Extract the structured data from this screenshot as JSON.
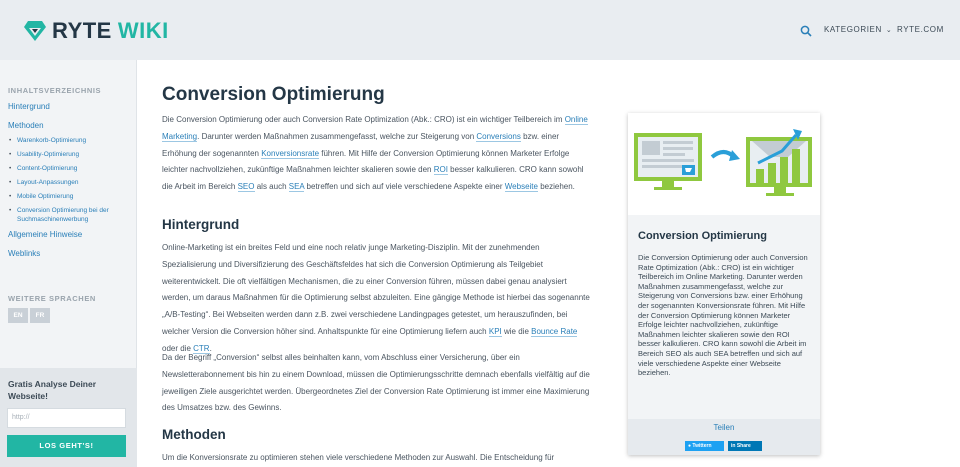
{
  "header": {
    "logo_ryte": "RYTE",
    "logo_wiki": "WIKI",
    "nav_kategorien": "KATEGORIEN",
    "nav_ryte": "RYTE.COM",
    "brand_color": "#22b6a4"
  },
  "sidebar": {
    "toc_heading": "INHALTSVERZEICHNIS",
    "toc": [
      {
        "label": "Hintergrund"
      },
      {
        "label": "Methoden"
      },
      {
        "label": "Warenkorb-Optimierung"
      },
      {
        "label": "Usability-Optimierung"
      },
      {
        "label": "Content-Optimierung"
      },
      {
        "label": "Layout-Anpassungen"
      },
      {
        "label": "Mobile Optimierung"
      },
      {
        "label": "Conversion Optimierung bei der Suchmaschinenwerbung"
      },
      {
        "label": "Allgemeine Hinweise"
      },
      {
        "label": "Weblinks"
      }
    ],
    "lang_heading": "WEITERE SPRACHEN",
    "langs": [
      "EN",
      "FR"
    ],
    "cta": {
      "title": "Gratis Analyse Deiner Webseite!",
      "placeholder": "http://",
      "button": "LOS GEHT'S!"
    }
  },
  "main": {
    "title": "Conversion Optimierung",
    "intro": {
      "t1": "Die Conversion Optimierung oder auch Conversion Rate Optimization (Abk.: CRO) ist ein wichtiger Teilbereich im ",
      "l1": "Online Marketing",
      "t2": ". Darunter werden Maßnahmen zusammengefasst, welche zur Steigerung von ",
      "l2": "Conversions",
      "t3": " bzw. einer Erhöhung der sogenannten ",
      "l3": "Konversionsrate",
      "t4": " führen. Mit Hilfe der Conversion Optimierung können Marketer Erfolge leichter nachvollziehen, zukünftige Maßnahmen leichter skalieren sowie den ",
      "l4": "ROI",
      "t5": " besser kalkulieren. CRO kann sowohl die Arbeit im Bereich ",
      "l5": "SEO",
      "t6": " als auch ",
      "l6": "SEA",
      "t7": " betreffen und sich auf viele verschiedene Aspekte einer ",
      "l7": "Webseite",
      "t8": " beziehen."
    },
    "h_hintergrund": "Hintergrund",
    "p2": {
      "t1": "Online-Marketing ist ein breites Feld und eine noch relativ junge Marketing-Disziplin. Mit der zunehmenden Spezialisierung und Diversifizierung des Geschäftsfeldes hat sich die Conversion Optimierung als Teilgebiet weiterentwickelt. Die oft vielfältigen Mechanismen, die zu einer Conversion führen, müssen dabei genau analysiert werden, um daraus Maßnahmen für die Optimierung selbst abzuleiten. Eine gängige Methode ist hierbei das sogenannte „A/B-Testing“. Bei Webseiten werden dann z.B. zwei verschiedene Landingpages getestet, um herauszufinden, bei welcher Version die Conversion höher sind. Anhaltspunkte für eine Optimierung liefern auch ",
      "l1": "KPI",
      "t2": " wie die ",
      "l2": "Bounce Rate",
      "t3": " oder die ",
      "l3": "CTR",
      "t4": "."
    },
    "p3": "Da der Begriff „Conversion“ selbst alles beinhalten kann, vom Abschluss einer Versicherung, über ein Newsletterabonnement bis hin zu einem Download, müssen die Optimierungsschritte demnach ebenfalls vielfältig auf die jeweiligen Ziele ausgerichtet werden. Übergeordnetes Ziel der Conversion Rate Optimierung ist immer eine Maximierung des Umsatzes bzw. des Gewinns.",
    "h_methoden": "Methoden",
    "p4": "Um die Konversionsrate zu optimieren stehen viele verschiedene Methoden zur Auswahl. Die Entscheidung für"
  },
  "card": {
    "title": "Conversion Optimierung",
    "text": "Die Conversion Optimierung oder auch Conversion Rate Optimization (Abk.: CRO) ist ein wichtiger Teilbereich im Online Marketing. Darunter werden Maßnahmen zusammengefasst, welche zur Steigerung von Conversions bzw. einer Erhöhung der sogenannten Konversionsrate führen. Mit Hilfe der Conversion Optimierung können Marketer Erfolge leichter nachvollziehen, zukünftige Maßnahmen leichter skalieren sowie den ROI besser kalkulieren. CRO kann sowohl die Arbeit im Bereich SEO als auch SEA betreffen und sich auf viele verschiedene Aspekte einer Webseite beziehen.",
    "share_label": "Teilen",
    "twitter_label": "Twittern",
    "linkedin_label": "Share"
  }
}
